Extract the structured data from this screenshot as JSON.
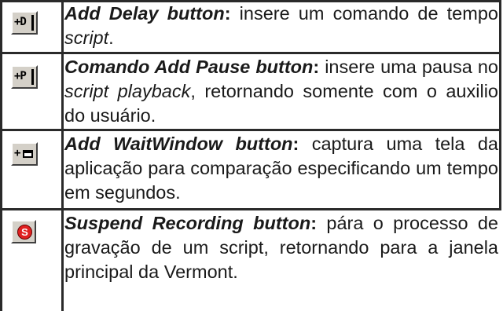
{
  "rows": [
    {
      "icon": "add-delay-icon",
      "icon_label": "+D",
      "title": "Add Delay button",
      "colon": ":",
      "text_before": " insere um comando de tempo ",
      "italic": "script",
      "text_after": "."
    },
    {
      "icon": "add-pause-icon",
      "icon_label": "+P",
      "title": "Comando Add Pause button",
      "colon": ":",
      "text_before": " insere uma pausa no ",
      "italic": "script playback",
      "text_after": ", retornando somente com o auxilio do usuário."
    },
    {
      "icon": "add-waitwindow-icon",
      "icon_label": "+",
      "title": "Add WaitWindow button",
      "colon": ":",
      "text_before": " captura uma tela da aplicação para comparação especificando um tempo em segundos."
    },
    {
      "icon": "suspend-recording-icon",
      "icon_label": "S",
      "title": "Suspend Recording button",
      "colon": ":",
      "text_before": " pára o processo de gravação de um script, retornando para a janela principal da Vermont."
    }
  ]
}
